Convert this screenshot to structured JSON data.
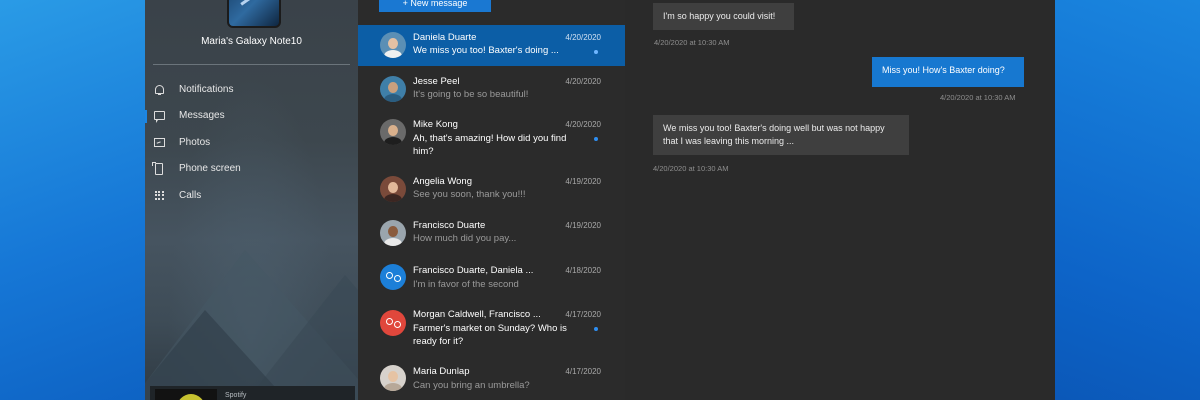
{
  "device": {
    "name": "Maria's Galaxy Note10"
  },
  "nav": [
    {
      "label": "Notifications",
      "icon": "bell-icon"
    },
    {
      "label": "Messages",
      "icon": "message-icon",
      "active": true
    },
    {
      "label": "Photos",
      "icon": "photo-icon"
    },
    {
      "label": "Phone screen",
      "icon": "phone-screen-icon"
    },
    {
      "label": "Calls",
      "icon": "dialpad-icon"
    }
  ],
  "now_playing": {
    "app": "Spotify"
  },
  "list": {
    "new_message_label": "+ New message",
    "conversations": [
      {
        "name": "Daniela Duarte",
        "date": "4/20/2020",
        "preview": "We miss you too! Baxter's doing ...",
        "unread": true,
        "selected": true
      },
      {
        "name": "Jesse Peel",
        "date": "4/20/2020",
        "preview": "It's going to be so beautiful!",
        "unread": false
      },
      {
        "name": "Mike Kong",
        "date": "4/20/2020",
        "preview": "Ah, that's amazing! How did you find him?",
        "unread": true
      },
      {
        "name": "Angelia Wong",
        "date": "4/19/2020",
        "preview": "See you soon, thank you!!!",
        "unread": false
      },
      {
        "name": "Francisco Duarte",
        "date": "4/19/2020",
        "preview": "How much did you pay...",
        "unread": false
      },
      {
        "name": "Francisco Duarte, Daniela ...",
        "date": "4/18/2020",
        "preview": "I'm in favor of the second",
        "unread": false,
        "group": true
      },
      {
        "name": "Morgan Caldwell, Francisco ...",
        "date": "4/17/2020",
        "preview": "Farmer's market on Sunday? Who is ready for it?",
        "unread": true,
        "group": true
      },
      {
        "name": "Maria Dunlap",
        "date": "4/17/2020",
        "preview": "Can you bring an umbrella?",
        "unread": false
      }
    ]
  },
  "chat": {
    "messages": [
      {
        "direction": "incoming",
        "text": "I'm so happy you could visit!",
        "timestamp": "4/20/2020 at 10:30 AM"
      },
      {
        "direction": "outgoing",
        "text": "Miss you! How's Baxter doing?",
        "timestamp": "4/20/2020 at 10:30 AM"
      },
      {
        "direction": "incoming",
        "text": "We miss you too! Baxter's doing well but was not happy that I was leaving this morning ...",
        "timestamp": "4/20/2020 at 10:30 AM"
      }
    ]
  },
  "colors": {
    "accent": "#1a78d2",
    "selected_row": "#0c5ea6",
    "unread_dot": "#2e8ef0",
    "group_avatar_blue": "#1c7fd8",
    "group_avatar_red": "#e0473c"
  }
}
